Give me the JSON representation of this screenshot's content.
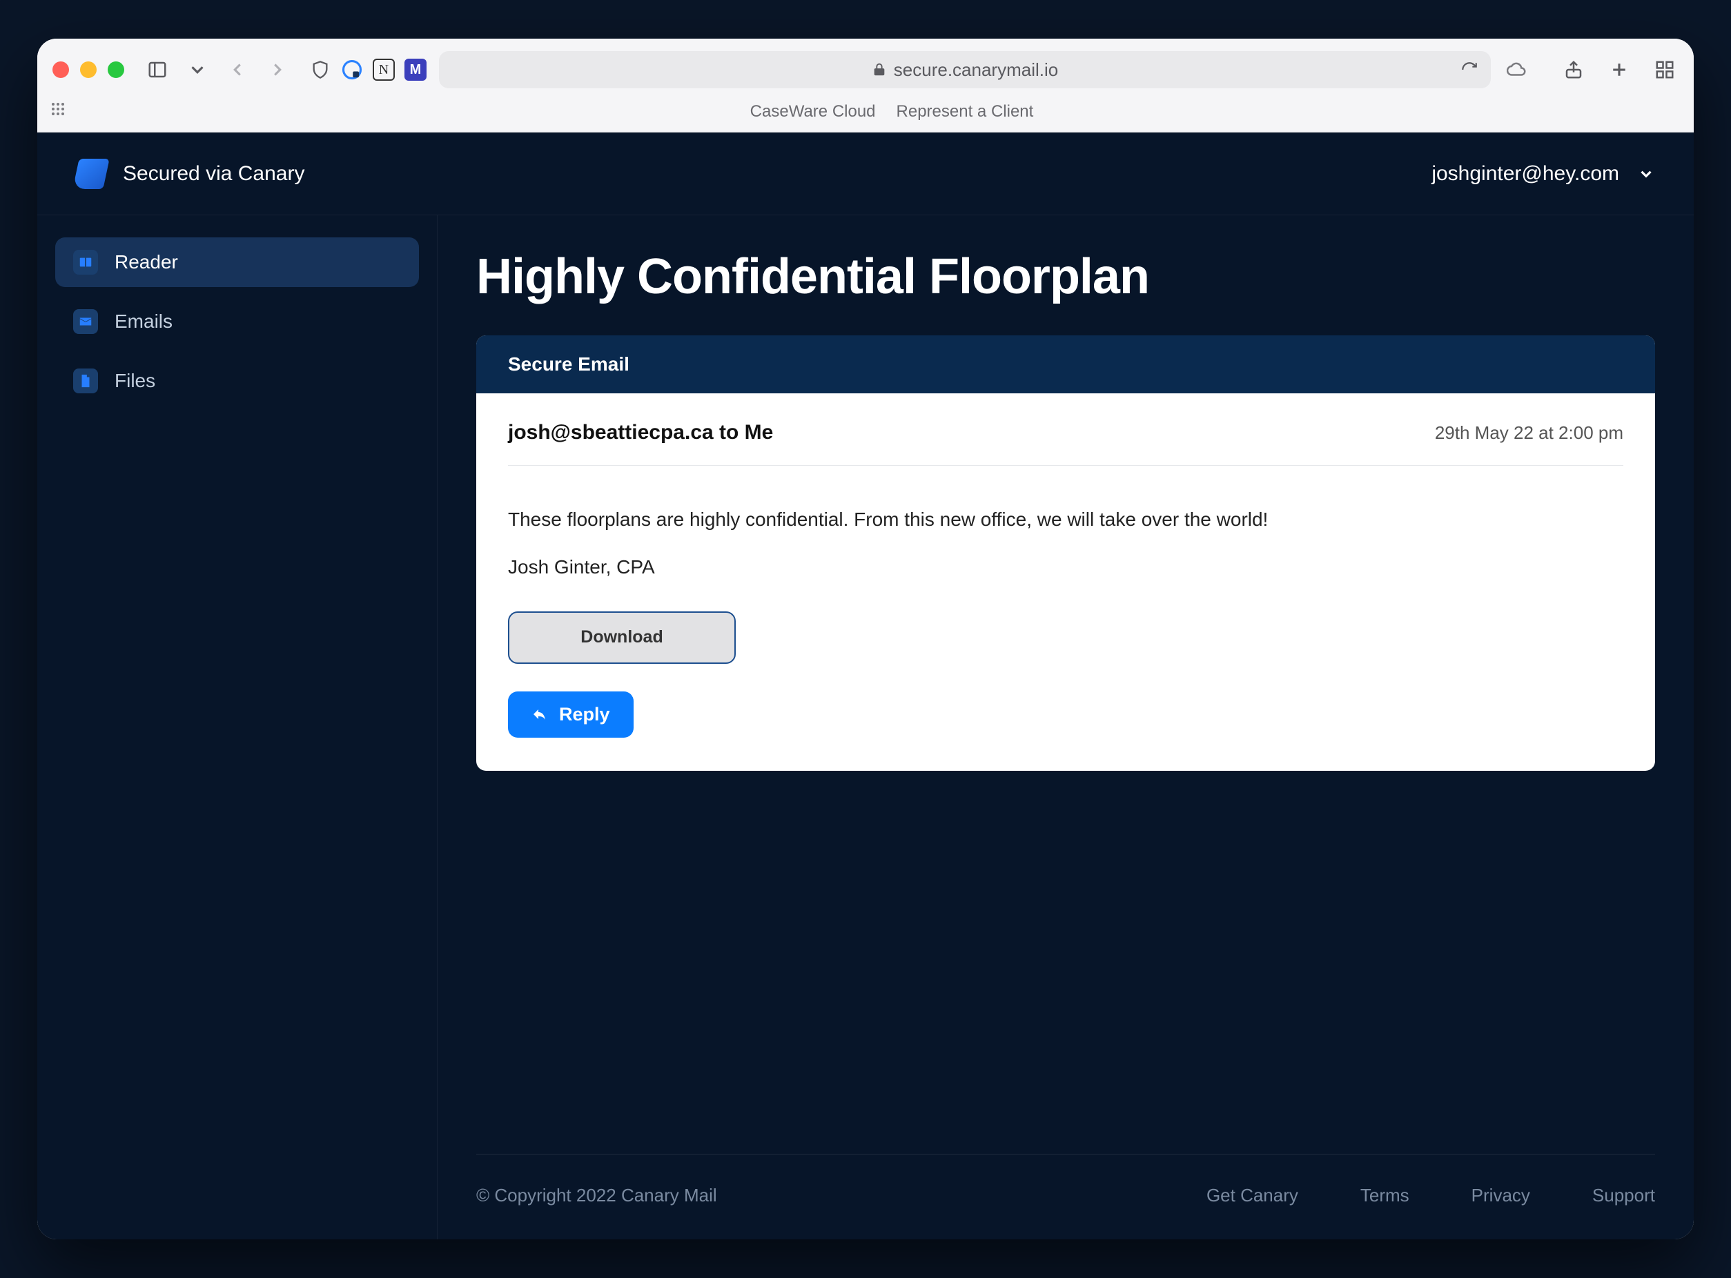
{
  "browser": {
    "url": "secure.canarymail.io",
    "bookmarks": [
      "CaseWare Cloud",
      "Represent a Client"
    ]
  },
  "header": {
    "brand": "Secured via Canary",
    "user_email": "joshginter@hey.com"
  },
  "sidebar": {
    "items": [
      {
        "label": "Reader",
        "icon": "reader",
        "active": true
      },
      {
        "label": "Emails",
        "icon": "emails",
        "active": false
      },
      {
        "label": "Files",
        "icon": "files",
        "active": false
      }
    ]
  },
  "main": {
    "title": "Highly Confidential Floorplan",
    "card_header": "Secure Email",
    "from": "josh@sbeattiecpa.ca to Me",
    "date": "29th May 22 at 2:00 pm",
    "body": "These floorplans are highly confidential. From this new office, we will take over the world!",
    "signature": "Josh Ginter, CPA",
    "download_label": "Download",
    "reply_label": "Reply"
  },
  "footer": {
    "copyright": "© Copyright 2022 Canary Mail",
    "links": [
      "Get Canary",
      "Terms",
      "Privacy",
      "Support"
    ]
  }
}
